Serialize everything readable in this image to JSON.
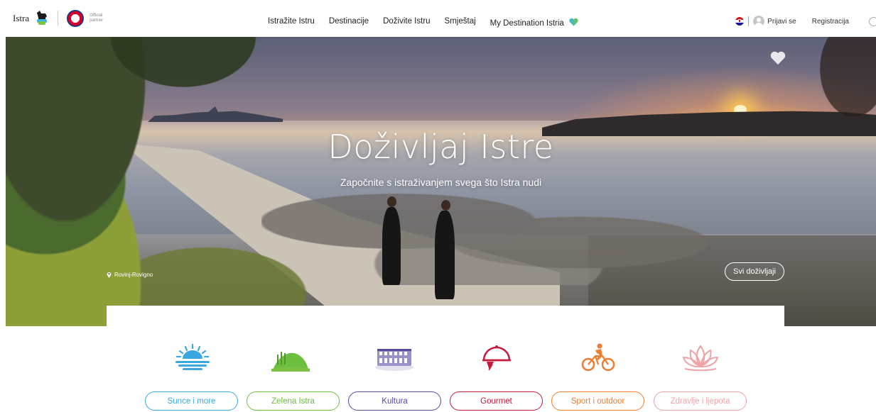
{
  "header": {
    "logo_text": "Istra",
    "partner_text": "Official partner",
    "nav": [
      "Istražite Istru",
      "Destinacije",
      "Doživite Istru",
      "Smještaj",
      "My Destination Istria"
    ],
    "login_label": "Prijavi se",
    "register_label": "Registracija",
    "language_flag": "hr"
  },
  "hero": {
    "title": "Doživljaj Istre",
    "subtitle": "Započnite s istraživanjem svega što Istra nudi",
    "location": "Rovinj-Rovigno",
    "all_button_label": "Svi doživljaji"
  },
  "categories": [
    {
      "label": "Sunce i more",
      "color": "#3aa7df",
      "icon": "sun-sea-icon"
    },
    {
      "label": "Zelena Istra",
      "color": "#6cbf3f",
      "icon": "green-hill-icon"
    },
    {
      "label": "Kultura",
      "color": "#5a4aa0",
      "icon": "arena-icon"
    },
    {
      "label": "Gourmet",
      "color": "#c8193c",
      "icon": "cloche-icon"
    },
    {
      "label": "Sport i outdoor",
      "color": "#ef7d2f",
      "icon": "cyclist-icon"
    },
    {
      "label": "Zdravlje i ljepota",
      "color": "#f0a2a6",
      "icon": "lotus-icon"
    }
  ]
}
